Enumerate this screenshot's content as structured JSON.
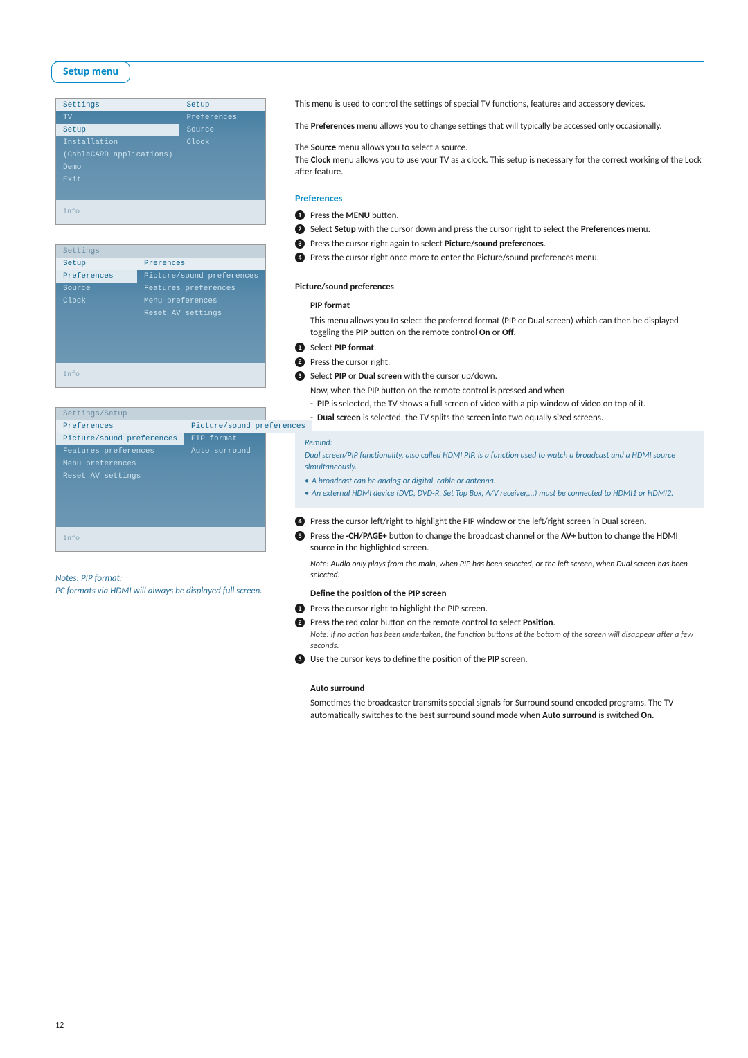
{
  "page": {
    "title": "Setup menu",
    "number": "12"
  },
  "osd1": {
    "left_header": "Settings",
    "right_header": "Setup",
    "left_items": [
      "TV",
      "Setup",
      "Installation",
      "(CableCARD applications)",
      "Demo",
      "Exit"
    ],
    "left_highlight_index": 1,
    "right_items": [
      "Preferences",
      "Source",
      "Clock"
    ],
    "info": "Info"
  },
  "osd2": {
    "title": "Settings",
    "left_header": "Setup",
    "right_header": "Prerences",
    "left_items": [
      "Preferences",
      "Source",
      "Clock"
    ],
    "left_highlight_index": 0,
    "right_items": [
      "Picture/sound preferences",
      "Features preferences",
      "Menu preferences",
      "Reset AV settings"
    ],
    "info": "Info"
  },
  "osd3": {
    "title": "Settings/Setup",
    "left_header": "Preferences",
    "right_header": "Picture/sound preferences",
    "left_items": [
      "Picture/sound preferences",
      "Features preferences",
      "Menu preferences",
      "Reset AV settings"
    ],
    "left_highlight_index": 0,
    "right_items": [
      "PIP format",
      "Auto surround"
    ],
    "info": "Info"
  },
  "intro": {
    "p1": "This menu is used to control the settings of special TV functions, features and accessory devices.",
    "p2a": "The ",
    "p2b": "Preferences",
    "p2c": " menu allows you to change settings that will typically be accessed only occasionally.",
    "p3a": "The ",
    "p3b": "Source",
    "p3c": " menu allows you to select a source.",
    "p4a": "The ",
    "p4b": "Clock",
    "p4c": " menu allows you to use your TV as a clock. This setup is necessary for the correct working of the Lock after feature."
  },
  "prefs": {
    "heading": "Preferences",
    "s1a": "Press the ",
    "s1b": "MENU",
    "s1c": " button.",
    "s2a": "Select ",
    "s2b": "Setup",
    "s2c": " with the cursor down and press the cursor right to select the ",
    "s2d": "Preferences",
    "s2e": " menu.",
    "s3a": "Press the cursor right again to select ",
    "s3b": "Picture/sound preferences",
    "s3c": ".",
    "s4": "Press the cursor right once more to enter the Picture/sound preferences menu."
  },
  "pip": {
    "heading": "Picture/sound preferences",
    "sub": "PIP format",
    "intro_a": "This menu allows you to select the preferred format (PIP or Dual screen) which can then be displayed toggling the ",
    "intro_b": "PIP",
    "intro_c": " button on the remote control ",
    "intro_d": "On",
    "intro_e": " or ",
    "intro_f": "Off",
    "intro_g": ".",
    "s1a": "Select ",
    "s1b": "PIP format",
    "s1c": ".",
    "s2": "Press the cursor right.",
    "s3a": "Select ",
    "s3b": "PIP",
    "s3c": " or ",
    "s3d": "Dual screen",
    "s3e": " with the cursor up/down.",
    "s3_note": "Now, when the PIP button on the remote control is pressed and when",
    "bullet1a": "PIP",
    "bullet1b": " is selected, the TV shows a full screen of video with a pip window of video on top of it.",
    "bullet2a": "Dual screen",
    "bullet2b": " is selected, the TV splits the screen into two equally sized screens.",
    "remind_head": "Remind:",
    "remind_p1": "Dual screen/PIP functionality, also called HDMI PIP, is a function used to watch a broadcast and a HDMI source simultaneously.",
    "remind_li1": "A broadcast can be analog or digital, cable or antenna.",
    "remind_li2": "An external HDMI device (DVD, DVD-R, Set Top Box, A/V receiver,...) must be connected to HDMI1 or HDMI2.",
    "s4": "Press the cursor left/right to highlight the PIP window or the left/right screen in Dual screen.",
    "s5a": "Press the ",
    "s5b": "-CH/PAGE+",
    "s5c": " button to change the broadcast channel or the ",
    "s5d": "AV+",
    "s5e": " button to change the HDMI source in the highlighted screen.",
    "audio_note": "Note: Audio only plays from the main, when PIP has been selected, or the left screen, when Dual screen has been selected."
  },
  "pos": {
    "heading": "Define the position of the PIP screen",
    "s1": "Press the cursor right to highlight the PIP screen.",
    "s2a": "Press the red color button on the remote control to select ",
    "s2b": "Position",
    "s2c": ".",
    "s2_note": "Note: If no action has been undertaken, the function buttons at the bottom of the screen will disappear after a few seconds.",
    "s3": "Use the cursor keys to define the position of the PIP screen."
  },
  "auto": {
    "heading": "Auto surround",
    "p_a": "Sometimes the broadcaster transmits special signals for Surround sound encoded programs. The TV automatically switches to the best surround sound mode when ",
    "p_b": "Auto surround",
    "p_c": " is switched ",
    "p_d": "On",
    "p_e": "."
  },
  "left_notes": {
    "l1": "Notes: PIP format:",
    "l2": "PC formats via HDMI will always be displayed full screen."
  }
}
